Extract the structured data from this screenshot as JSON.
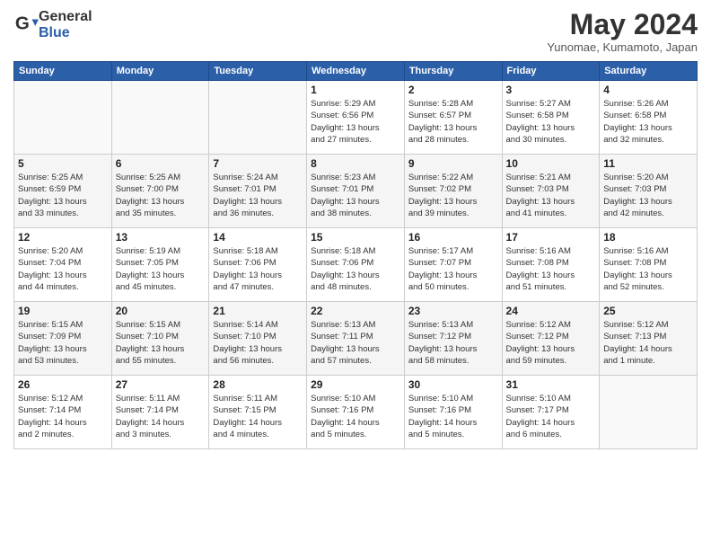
{
  "header": {
    "logo_general": "General",
    "logo_blue": "Blue",
    "month_title": "May 2024",
    "location": "Yunomae, Kumamoto, Japan"
  },
  "days_of_week": [
    "Sunday",
    "Monday",
    "Tuesday",
    "Wednesday",
    "Thursday",
    "Friday",
    "Saturday"
  ],
  "weeks": [
    [
      {
        "day": "",
        "info": ""
      },
      {
        "day": "",
        "info": ""
      },
      {
        "day": "",
        "info": ""
      },
      {
        "day": "1",
        "info": "Sunrise: 5:29 AM\nSunset: 6:56 PM\nDaylight: 13 hours\nand 27 minutes."
      },
      {
        "day": "2",
        "info": "Sunrise: 5:28 AM\nSunset: 6:57 PM\nDaylight: 13 hours\nand 28 minutes."
      },
      {
        "day": "3",
        "info": "Sunrise: 5:27 AM\nSunset: 6:58 PM\nDaylight: 13 hours\nand 30 minutes."
      },
      {
        "day": "4",
        "info": "Sunrise: 5:26 AM\nSunset: 6:58 PM\nDaylight: 13 hours\nand 32 minutes."
      }
    ],
    [
      {
        "day": "5",
        "info": "Sunrise: 5:25 AM\nSunset: 6:59 PM\nDaylight: 13 hours\nand 33 minutes."
      },
      {
        "day": "6",
        "info": "Sunrise: 5:25 AM\nSunset: 7:00 PM\nDaylight: 13 hours\nand 35 minutes."
      },
      {
        "day": "7",
        "info": "Sunrise: 5:24 AM\nSunset: 7:01 PM\nDaylight: 13 hours\nand 36 minutes."
      },
      {
        "day": "8",
        "info": "Sunrise: 5:23 AM\nSunset: 7:01 PM\nDaylight: 13 hours\nand 38 minutes."
      },
      {
        "day": "9",
        "info": "Sunrise: 5:22 AM\nSunset: 7:02 PM\nDaylight: 13 hours\nand 39 minutes."
      },
      {
        "day": "10",
        "info": "Sunrise: 5:21 AM\nSunset: 7:03 PM\nDaylight: 13 hours\nand 41 minutes."
      },
      {
        "day": "11",
        "info": "Sunrise: 5:20 AM\nSunset: 7:03 PM\nDaylight: 13 hours\nand 42 minutes."
      }
    ],
    [
      {
        "day": "12",
        "info": "Sunrise: 5:20 AM\nSunset: 7:04 PM\nDaylight: 13 hours\nand 44 minutes."
      },
      {
        "day": "13",
        "info": "Sunrise: 5:19 AM\nSunset: 7:05 PM\nDaylight: 13 hours\nand 45 minutes."
      },
      {
        "day": "14",
        "info": "Sunrise: 5:18 AM\nSunset: 7:06 PM\nDaylight: 13 hours\nand 47 minutes."
      },
      {
        "day": "15",
        "info": "Sunrise: 5:18 AM\nSunset: 7:06 PM\nDaylight: 13 hours\nand 48 minutes."
      },
      {
        "day": "16",
        "info": "Sunrise: 5:17 AM\nSunset: 7:07 PM\nDaylight: 13 hours\nand 50 minutes."
      },
      {
        "day": "17",
        "info": "Sunrise: 5:16 AM\nSunset: 7:08 PM\nDaylight: 13 hours\nand 51 minutes."
      },
      {
        "day": "18",
        "info": "Sunrise: 5:16 AM\nSunset: 7:08 PM\nDaylight: 13 hours\nand 52 minutes."
      }
    ],
    [
      {
        "day": "19",
        "info": "Sunrise: 5:15 AM\nSunset: 7:09 PM\nDaylight: 13 hours\nand 53 minutes."
      },
      {
        "day": "20",
        "info": "Sunrise: 5:15 AM\nSunset: 7:10 PM\nDaylight: 13 hours\nand 55 minutes."
      },
      {
        "day": "21",
        "info": "Sunrise: 5:14 AM\nSunset: 7:10 PM\nDaylight: 13 hours\nand 56 minutes."
      },
      {
        "day": "22",
        "info": "Sunrise: 5:13 AM\nSunset: 7:11 PM\nDaylight: 13 hours\nand 57 minutes."
      },
      {
        "day": "23",
        "info": "Sunrise: 5:13 AM\nSunset: 7:12 PM\nDaylight: 13 hours\nand 58 minutes."
      },
      {
        "day": "24",
        "info": "Sunrise: 5:12 AM\nSunset: 7:12 PM\nDaylight: 13 hours\nand 59 minutes."
      },
      {
        "day": "25",
        "info": "Sunrise: 5:12 AM\nSunset: 7:13 PM\nDaylight: 14 hours\nand 1 minute."
      }
    ],
    [
      {
        "day": "26",
        "info": "Sunrise: 5:12 AM\nSunset: 7:14 PM\nDaylight: 14 hours\nand 2 minutes."
      },
      {
        "day": "27",
        "info": "Sunrise: 5:11 AM\nSunset: 7:14 PM\nDaylight: 14 hours\nand 3 minutes."
      },
      {
        "day": "28",
        "info": "Sunrise: 5:11 AM\nSunset: 7:15 PM\nDaylight: 14 hours\nand 4 minutes."
      },
      {
        "day": "29",
        "info": "Sunrise: 5:10 AM\nSunset: 7:16 PM\nDaylight: 14 hours\nand 5 minutes."
      },
      {
        "day": "30",
        "info": "Sunrise: 5:10 AM\nSunset: 7:16 PM\nDaylight: 14 hours\nand 5 minutes."
      },
      {
        "day": "31",
        "info": "Sunrise: 5:10 AM\nSunset: 7:17 PM\nDaylight: 14 hours\nand 6 minutes."
      },
      {
        "day": "",
        "info": ""
      }
    ]
  ]
}
